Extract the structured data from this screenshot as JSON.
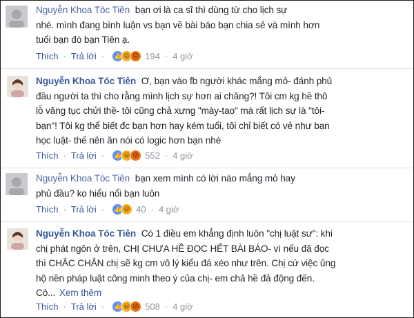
{
  "comments": [
    {
      "author": "Nguyễn Khoa Tóc Tiên",
      "author_style": "blurred",
      "text": "bạn ơi là ca sĩ thì dùng từ cho lịch sự nhé. mình đang bình luận vs bạn về bài báo bạn chia sẻ và mình hơn tuổi bạn đó bạn Tiên ạ.",
      "lines": [
        "bạn ơi là ca sĩ thì dùng từ cho lịch sự",
        "nhé. mình đang bình luận vs bạn về bài báo bạn chia sẻ và mình hơn",
        "tuổi bạn đó bạn Tiên ạ."
      ],
      "like_label": "Thích",
      "reply_label": "Trả lời",
      "reactions": [
        "like",
        "haha",
        "angry"
      ],
      "reaction_count": "194",
      "time": "4 giờ"
    },
    {
      "author": "Nguyễn Khoa Tóc Tiên",
      "author_style": "bold",
      "lines": [
        "Ơ, bạn vào fb người khác mắng mỏ- đánh phủ",
        "đầu người ta thì cho rằng mình lịch sự hơn ai chăng?! Tôi cm kg hề thô",
        "lỗ văng tục chửi thề- tôi cũng chả xưng \"mày-tao\" mà rất lịch sự là \"tôi-",
        "bạn\"! Tôi kg thể biết đc bạn hơn hay kém tuổi, tôi chỉ biết có vẻ như bạn",
        "học luật- thế nên ăn nói có logic hơn bạn nhé"
      ],
      "like_label": "Thích",
      "reply_label": "Trả lời",
      "reactions": [
        "like",
        "haha",
        "angry"
      ],
      "reaction_count": "552",
      "time": "4 giờ"
    },
    {
      "author": "Nguyễn Khoa Tóc Tiên",
      "author_style": "blurred",
      "lines": [
        "bạn xem mình có lời nào mắng mỏ hay",
        "phủ đầu? ko hiểu nổi bạn luôn"
      ],
      "like_label": "Thích",
      "reply_label": "Trả lời",
      "reactions": [
        "like",
        "haha"
      ],
      "reaction_count": "40",
      "time": "4 giờ"
    },
    {
      "author": "Nguyễn Khoa Tóc Tiên",
      "author_style": "bold",
      "lines": [
        "Có 1 điều em khẳng định luôn \"chị luật sư\": khi",
        "chị phát ngôn ở trên, CHỊ CHƯA HỀ ĐỌC HẾT BÀI BÁO- vì nếu đã đọc",
        "thì CHẮC CHẮN chị sẽ kg cm vô lý kiểu đá xéo như trên. Chị cứ việc ủng",
        "hộ nền pháp luật công minh theo ý của chị- em chả hề đả động đến.",
        "Cò..."
      ],
      "see_more": "Xem thêm",
      "like_label": "Thích",
      "reply_label": "Trả lời",
      "reactions": [
        "like",
        "haha",
        "angry"
      ],
      "reaction_count": "508",
      "time": "4 giờ"
    }
  ],
  "colors": {
    "author": "#365899",
    "text": "#1d2129",
    "meta_gray": "#90949c",
    "separator": "#dddfe2"
  }
}
